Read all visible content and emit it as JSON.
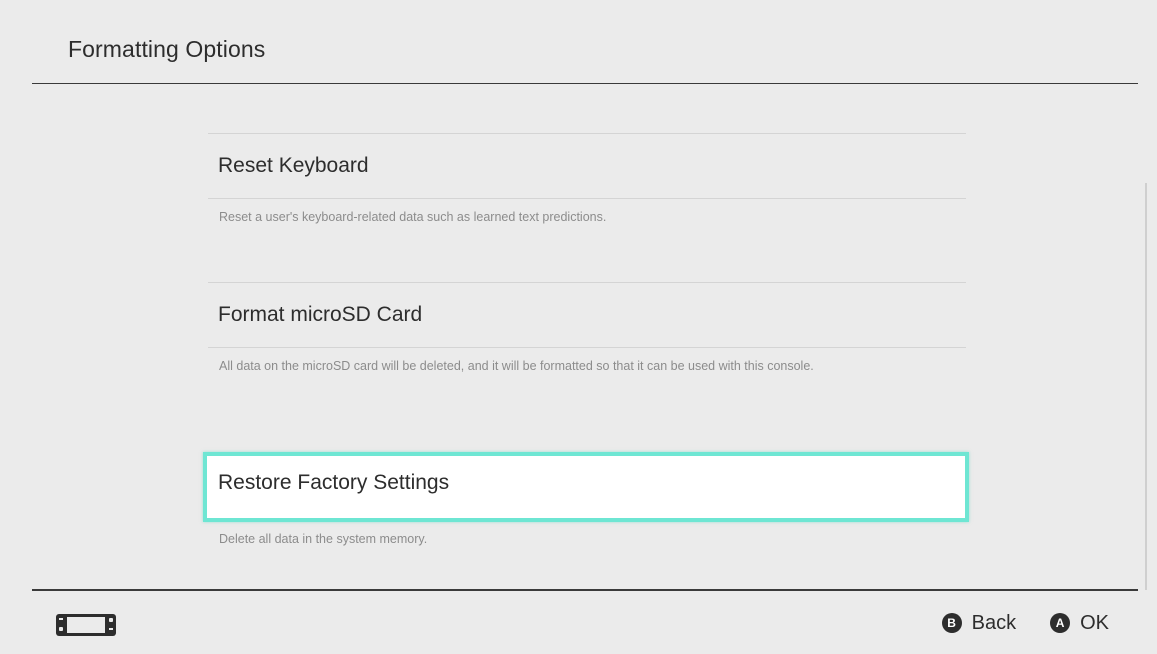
{
  "header": {
    "title": "Formatting Options"
  },
  "options": [
    {
      "label": "Reset Keyboard",
      "description": "Reset a user's keyboard-related data such as learned text predictions.",
      "selected": false
    },
    {
      "label": "Format microSD Card",
      "description": "All data on the microSD card will be deleted, and it will be formatted so that it can be used with this console.",
      "selected": false
    },
    {
      "label": "Restore Factory Settings",
      "description": "Delete all data in the system memory.",
      "selected": true
    }
  ],
  "footer": {
    "left_icon": "console-icon",
    "actions": [
      {
        "button": "B",
        "label": "Back",
        "icon": "b-button-icon"
      },
      {
        "button": "A",
        "label": "OK",
        "icon": "a-button-icon"
      }
    ]
  },
  "colors": {
    "background": "#ebebeb",
    "text": "#2d2d2d",
    "description_text": "#8c8c8c",
    "selection_border": "#6ee6d3",
    "rule": "#3a3a3a"
  }
}
